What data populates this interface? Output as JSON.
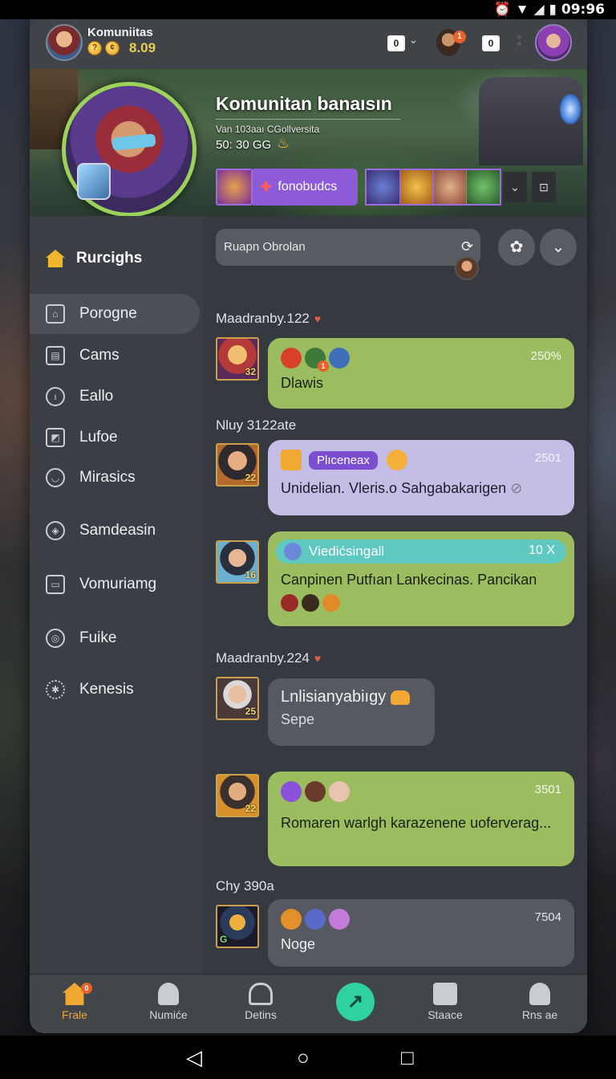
{
  "status_bar": {
    "time": "09:96"
  },
  "top_bar": {
    "title": "Komuniitas",
    "coins": "8.09",
    "counter_box": "0",
    "badge": "1",
    "square_label": "0"
  },
  "banner": {
    "title": "Komunitan banaısın",
    "subtitle_1": "Van 103aaı CGollversita",
    "subtitle_2": "50: 30 GG",
    "chip_label": "fonobudcs"
  },
  "sidebar": {
    "header": "Rurcighs",
    "items": [
      {
        "label": "Porogne",
        "icon": "house-icon"
      },
      {
        "label": "Cams",
        "icon": "lock-icon"
      },
      {
        "label": "Eallo",
        "icon": "info-icon"
      },
      {
        "label": "Lufoe",
        "icon": "picture-icon"
      },
      {
        "label": "Mirasics",
        "icon": "shield-icon"
      },
      {
        "label": "Samdeasin",
        "icon": "target-icon"
      },
      {
        "label": "Vomuriamg",
        "icon": "screen-icon"
      },
      {
        "label": "Fuike",
        "icon": "eye-icon"
      },
      {
        "label": "Kenesis",
        "icon": "gear-icon"
      }
    ]
  },
  "chat": {
    "search_placeholder": "Ruapn Obrolan",
    "messages": [
      {
        "sender": "Maadranby.122",
        "level": "32",
        "timestamp": "250%",
        "text": "Dlawis",
        "emoji_badge": "1"
      },
      {
        "sender": "Nluy 3122ate",
        "level": "22",
        "timestamp": "2501",
        "tag": "Plıceneax",
        "text": "Unidelian. Vleris.o Sahgabakarigen"
      },
      {
        "level": "16",
        "timestamp": "10 X",
        "tag": "Viedićsingall",
        "text": "Canpinen Putfıan Lankecinas. Pancikan"
      },
      {
        "sender": "Maadranby.224",
        "level": "25",
        "title": "Lnlisianyabiıgy",
        "text": "Sepe"
      },
      {
        "level": "22",
        "timestamp": "3501",
        "text": "Romaren warlgh karazenene uoferverag..."
      },
      {
        "sender": "Chy 390a",
        "level": "G",
        "timestamp": "7504",
        "text": "Noge"
      }
    ]
  },
  "bottom_nav": {
    "items": [
      {
        "label": "Frale",
        "badge": "0"
      },
      {
        "label": "Numiće"
      },
      {
        "label": "Detins"
      },
      {
        "label": "Staace"
      },
      {
        "label": "Rns ae"
      }
    ]
  },
  "colors": {
    "accent": "#f0a832",
    "bubble_green": "#9bbd5f",
    "bubble_lavender": "#c4bde6",
    "chip_purple": "#8d5ad8",
    "chat_center_button": "#2fd1a0"
  }
}
